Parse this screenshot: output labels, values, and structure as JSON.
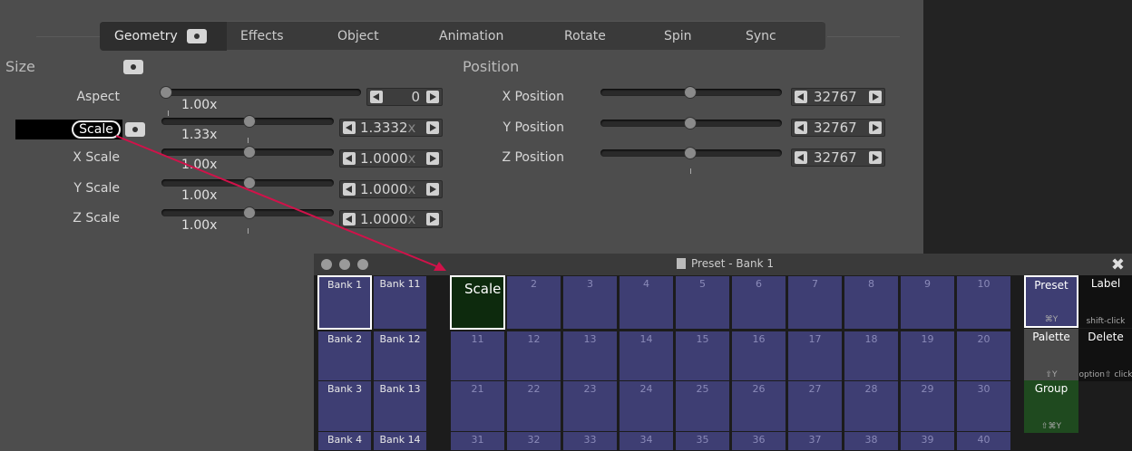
{
  "tabs": {
    "geometry": "Geometry",
    "effects": "Effects",
    "object": "Object",
    "animation": "Animation",
    "rotate": "Rotate",
    "spin": "Spin",
    "sync": "Sync"
  },
  "size": {
    "heading": "Size",
    "rows": [
      {
        "label": "Aspect",
        "value": "1.00x",
        "stepper": "0",
        "unit": ""
      },
      {
        "label": "Scale",
        "value": "1.33x",
        "stepper": "1.3332",
        "unit": "x"
      },
      {
        "label": "X Scale",
        "value": "1.00x",
        "stepper": "1.0000",
        "unit": "x"
      },
      {
        "label": "Y Scale",
        "value": "1.00x",
        "stepper": "1.0000",
        "unit": "x"
      },
      {
        "label": "Z Scale",
        "value": "1.00x",
        "stepper": "1.0000",
        "unit": "x"
      }
    ]
  },
  "position": {
    "heading": "Position",
    "rows": [
      {
        "label": "X Position",
        "stepper": "32767"
      },
      {
        "label": "Y Position",
        "stepper": "32767"
      },
      {
        "label": "Z Position",
        "stepper": "32767"
      }
    ]
  },
  "preset_window": {
    "title": "Preset - Bank 1",
    "banks": [
      [
        "Bank 1",
        "Bank 11"
      ],
      [
        "Bank 2",
        "Bank 12"
      ],
      [
        "Bank 3",
        "Bank 13"
      ],
      [
        "Bank 4",
        "Bank 14"
      ]
    ],
    "grid_rows": [
      [
        "Scale",
        "2",
        "3",
        "4",
        "5",
        "6",
        "7",
        "8",
        "9",
        "10"
      ],
      [
        "11",
        "12",
        "13",
        "14",
        "15",
        "16",
        "17",
        "18",
        "19",
        "20"
      ],
      [
        "21",
        "22",
        "23",
        "24",
        "25",
        "26",
        "27",
        "28",
        "29",
        "30"
      ],
      [
        "31",
        "32",
        "33",
        "34",
        "35",
        "36",
        "37",
        "38",
        "39",
        "40"
      ]
    ],
    "side": {
      "preset": {
        "label": "Preset",
        "shortcut": "⌘Y"
      },
      "label": {
        "label": "Label",
        "hint": "shift-click"
      },
      "palette": {
        "label": "Palette",
        "shortcut": "⇧Y"
      },
      "delete": {
        "label": "Delete",
        "hint": "option⇧ click"
      },
      "group": {
        "label": "Group",
        "shortcut": "⇧⌘Y"
      }
    }
  },
  "colors": {
    "cell": "#3e3e73",
    "filled_cell": "#0d2a0d",
    "palette": "#4a4a4a",
    "group": "#1f4a1f",
    "arrow": "#d0124a"
  }
}
